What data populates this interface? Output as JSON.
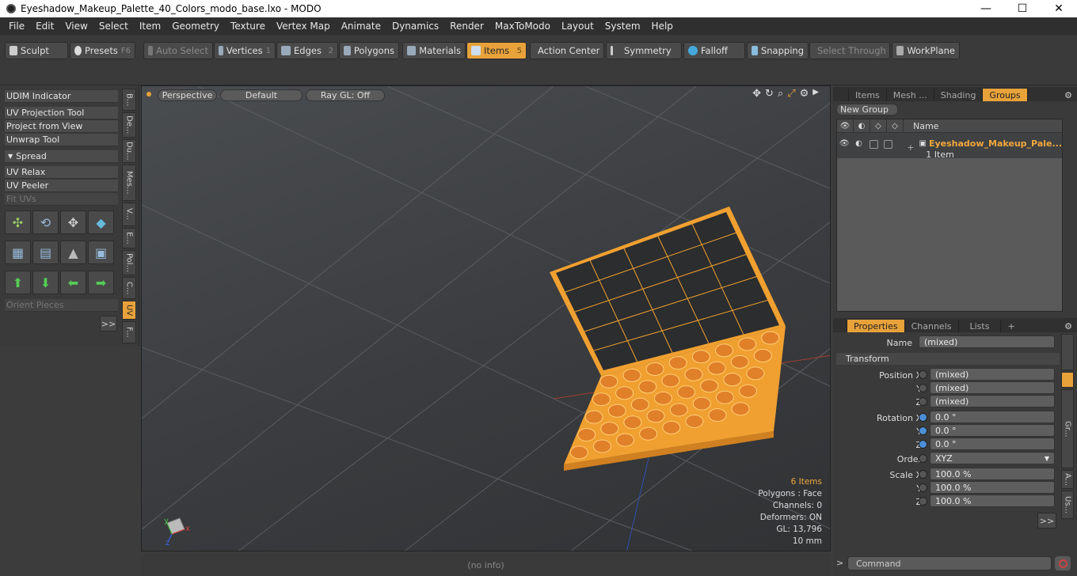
{
  "window": {
    "title": "Eyeshadow_Makeup_Palette_40_Colors_modo_base.lxo - MODO",
    "minimize": "—",
    "maximize": "☐",
    "close": "✕"
  },
  "menu": [
    "File",
    "Edit",
    "View",
    "Select",
    "Item",
    "Geometry",
    "Texture",
    "Vertex Map",
    "Animate",
    "Dynamics",
    "Render",
    "MaxToModo",
    "Layout",
    "System",
    "Help"
  ],
  "toolbar": {
    "sculpt": "Sculpt",
    "presets": "Presets",
    "presets_key": "F6",
    "auto_select": "Auto Select",
    "vertices": "Vertices",
    "vertices_key": "1",
    "edges": "Edges",
    "edges_key": "2",
    "polygons": "Polygons",
    "materials": "Materials",
    "items": "Items",
    "items_key": "5",
    "action_center": "Action Center",
    "symmetry": "Symmetry",
    "falloff": "Falloff",
    "snapping": "Snapping",
    "select_through": "Select Through",
    "workplane": "WorkPlane"
  },
  "left": {
    "buttons": [
      "UDIM Indicator",
      "UV Projection Tool",
      "Project from View",
      "Unwrap Tool"
    ],
    "spread": "Spread",
    "buttons2": [
      "UV Relax",
      "UV Peeler",
      "Fit UVs"
    ],
    "orient": "Orient Pieces",
    "more": ">>",
    "vtabs": [
      "B...",
      "De...",
      "Du...",
      "Mes...",
      "V...",
      "E...",
      "Pol...",
      "C...",
      "UV",
      "F..."
    ]
  },
  "viewport": {
    "perspective": "Perspective",
    "default": "Default",
    "raygl": "Ray GL: Off",
    "stats": {
      "items": "6 Items",
      "polygons": "Polygons : Face",
      "channels": "Channels: 0",
      "deformers": "Deformers: ON",
      "gl": "GL: 13,796",
      "scale": "10 mm"
    },
    "axis_x": "x",
    "axis_y": "y",
    "axis_z": "z"
  },
  "groups_panel": {
    "tabs": [
      "Items",
      "Mesh ...",
      "Shading",
      "Groups"
    ],
    "new_group": "New Group",
    "col_name": "Name",
    "group_name": "Eyeshadow_Makeup_Pale...",
    "group_count": "1 Item"
  },
  "properties_panel": {
    "tabs": [
      "Properties",
      "Channels",
      "Lists"
    ],
    "add": "+",
    "name_label": "Name",
    "name_value": "(mixed)",
    "transform": "Transform",
    "position_label": "Position X",
    "pos_x": "(mixed)",
    "pos_y": "(mixed)",
    "pos_z": "(mixed)",
    "rotation_label": "Rotation X",
    "rot_x": "0.0 °",
    "rot_y": "0.0 °",
    "rot_z": "0.0 °",
    "order_label": "Order",
    "order_value": "XYZ",
    "scale_label": "Scale X",
    "scale_x": "100.0 %",
    "scale_y": "100.0 %",
    "scale_z": "100.0 %",
    "y": "Y",
    "z": "Z",
    "more": ">>",
    "rvtabs": [
      "Gr...",
      "A...",
      "Us..."
    ]
  },
  "status": {
    "info": "(no info)",
    "command_placeholder": "Command",
    "prompt": ">"
  }
}
